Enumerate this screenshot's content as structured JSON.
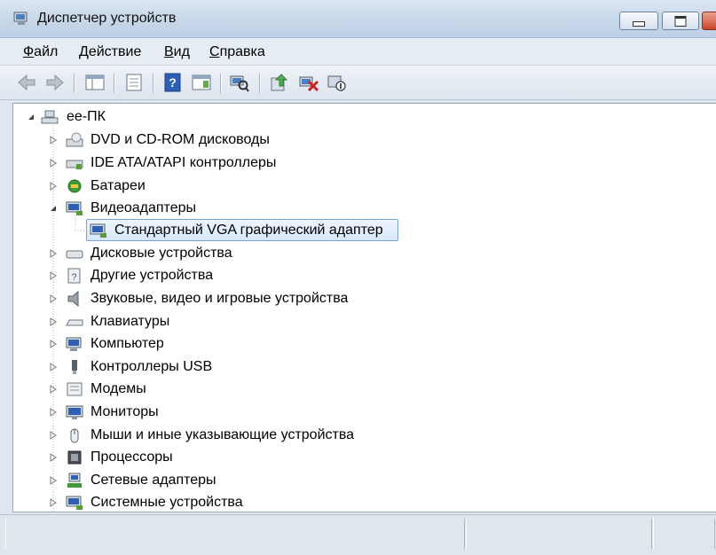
{
  "window": {
    "title": "Диспетчер устройств"
  },
  "menu": {
    "file": {
      "accel": "Ф",
      "rest": "айл"
    },
    "action": {
      "accel": "Д",
      "rest": "ействие"
    },
    "view": {
      "accel": "В",
      "rest": "ид"
    },
    "help": {
      "accel": "С",
      "rest": "правка"
    }
  },
  "toolbar": {
    "icons": [
      "back-arrow-icon",
      "forward-arrow-icon",
      "console-tree-icon",
      "properties-icon",
      "help-icon",
      "action-pane-icon",
      "scan-hardware-icon",
      "update-driver-icon",
      "uninstall-icon",
      "disable-device-icon"
    ]
  },
  "tree": {
    "root": "ee-ПК",
    "categories": [
      {
        "label": "DVD и CD-ROM дисководы",
        "icon": "dvd-drive-icon"
      },
      {
        "label": "IDE ATA/ATAPI контроллеры",
        "icon": "ide-controller-icon"
      },
      {
        "label": "Батареи",
        "icon": "battery-icon"
      },
      {
        "label": "Видеоадаптеры",
        "icon": "display-adapter-icon",
        "expanded": true
      },
      {
        "label": "Стандартный VGA графический адаптер",
        "icon": "vga-adapter-icon",
        "child": true,
        "selected": true
      },
      {
        "label": "Дисковые устройства",
        "icon": "disk-drive-icon"
      },
      {
        "label": "Другие устройства",
        "icon": "unknown-device-icon"
      },
      {
        "label": "Звуковые, видео и игровые устройства",
        "icon": "speaker-icon"
      },
      {
        "label": "Клавиатуры",
        "icon": "keyboard-icon"
      },
      {
        "label": "Компьютер",
        "icon": "computer-icon"
      },
      {
        "label": "Контроллеры USB",
        "icon": "usb-icon"
      },
      {
        "label": "Модемы",
        "icon": "modem-icon"
      },
      {
        "label": "Мониторы",
        "icon": "monitor-icon"
      },
      {
        "label": "Мыши и иные указывающие устройства",
        "icon": "mouse-icon"
      },
      {
        "label": "Процессоры",
        "icon": "processor-icon"
      },
      {
        "label": "Сетевые адаптеры",
        "icon": "network-adapter-icon"
      },
      {
        "label": "Системные устройства",
        "icon": "system-device-icon"
      }
    ]
  },
  "colors": {
    "selection_border": "#7da2ce",
    "selection_fill": "#d6e7fb"
  }
}
